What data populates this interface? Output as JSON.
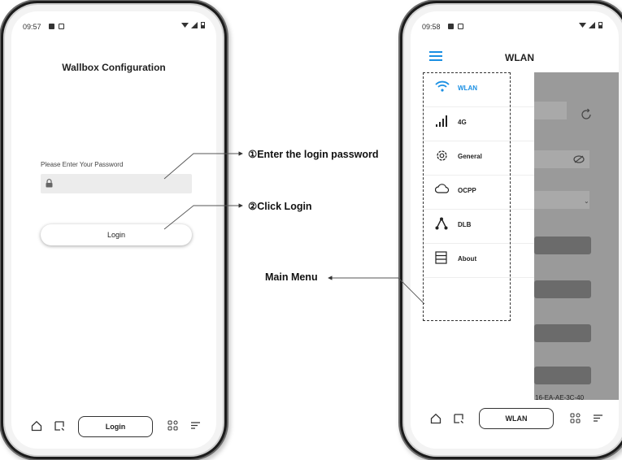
{
  "left_phone": {
    "status_time": "09:57",
    "page_title": "Wallbox Configuration",
    "password_label": "Please Enter Your Password",
    "login_button": "Login",
    "nav_center_label": "Login"
  },
  "right_phone": {
    "status_time": "09:58",
    "page_title": "WLAN",
    "menu": [
      {
        "label": "WLAN",
        "icon": "wifi-icon",
        "active": true
      },
      {
        "label": "4G",
        "icon": "signal-bars-icon"
      },
      {
        "label": "General",
        "icon": "gear-icon"
      },
      {
        "label": "OCPP",
        "icon": "cloud-icon"
      },
      {
        "label": "DLB",
        "icon": "network-triangle-icon"
      },
      {
        "label": "About",
        "icon": "document-list-icon"
      }
    ],
    "mac_fragment": "16-EA-AE-3C-40",
    "nav_center_label": "WLAN"
  },
  "annotations": {
    "step1": "①Enter the login password",
    "step2": "②Click Login",
    "main_menu": "Main Menu"
  },
  "colors": {
    "accent": "#1a8fe3",
    "overlay": "#9a9a9a",
    "dark_bar": "#6b6b6b"
  }
}
